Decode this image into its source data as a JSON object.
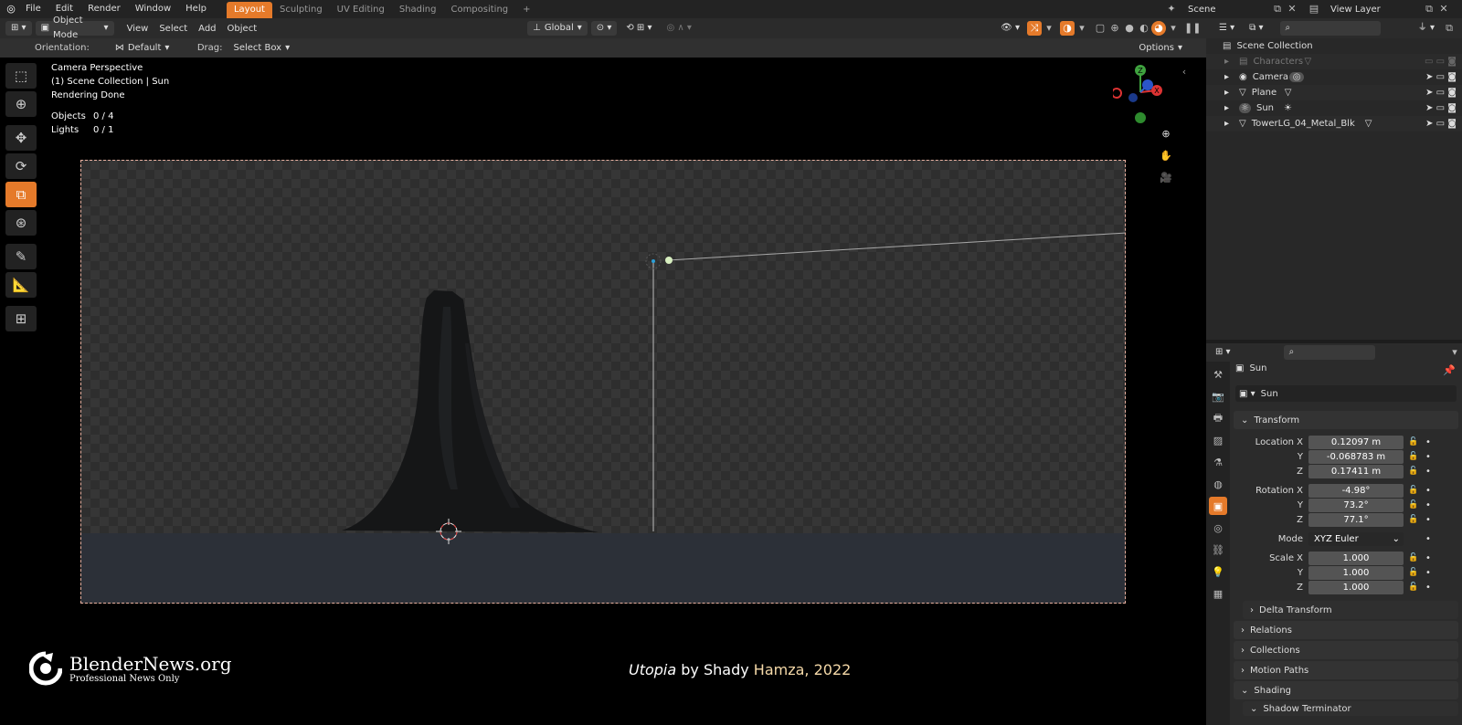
{
  "topbar": {
    "menus": [
      "File",
      "Edit",
      "Render",
      "Window",
      "Help"
    ],
    "workspaces": [
      "Layout",
      "Sculpting",
      "UV Editing",
      "Shading",
      "Compositing"
    ],
    "active_workspace": "Layout",
    "add_tab": "+",
    "scene": "Scene",
    "view_layer": "View Layer"
  },
  "header": {
    "mode": "Object Mode",
    "menus": [
      "View",
      "Select",
      "Add",
      "Object"
    ],
    "transform_orientation": "Global"
  },
  "tool_settings": {
    "orientation_label": "Orientation:",
    "orientation_value": "Default",
    "drag_label": "Drag:",
    "drag_value": "Select Box",
    "options": "Options"
  },
  "viewport": {
    "view_name": "Camera Perspective",
    "collection_info": "(1) Scene Collection | Sun",
    "status": "Rendering Done",
    "stats": [
      {
        "label": "Objects",
        "value": "0 / 4"
      },
      {
        "label": "Lights",
        "value": "0 / 1"
      }
    ]
  },
  "overlay": {
    "logo_name": "BlenderNews.org",
    "logo_tagline": "Professional News Only",
    "credit_title": "Utopia",
    "credit_by": " by Shady ",
    "credit_author": "Hamza, 2022"
  },
  "outliner": {
    "root": "Scene Collection",
    "items": [
      "Characters",
      "Camera",
      "Plane",
      "Sun",
      "TowerLG_04_Metal_Blk"
    ]
  },
  "properties": {
    "object_name": "Sun",
    "data_name": "Sun",
    "transform_title": "Transform",
    "location_label": "Location X",
    "location": [
      "0.12097 m",
      "-0.068783 m",
      "0.17411 m"
    ],
    "rotation_label": "Rotation X",
    "rotation": [
      "-4.98°",
      "73.2°",
      "77.1°"
    ],
    "mode_label": "Mode",
    "mode_value": "XYZ Euler",
    "scale_label": "Scale X",
    "scale": [
      "1.000",
      "1.000",
      "1.000"
    ],
    "axis_y": "Y",
    "axis_z": "Z",
    "sections": [
      "Delta Transform",
      "Relations",
      "Collections",
      "Motion Paths",
      "Shading",
      "Shadow Terminator"
    ]
  },
  "colors": {
    "accent": "#e57a2a",
    "background": "#000000"
  }
}
